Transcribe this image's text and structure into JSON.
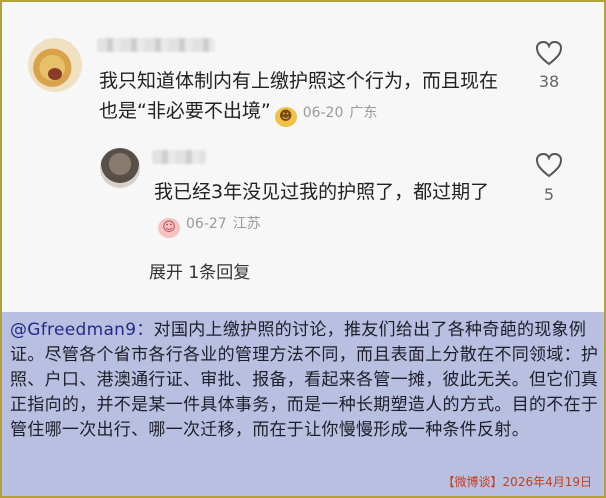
{
  "comments": [
    {
      "text": "我只知道体制内有上缴护照这个行为，而且现在也是“非必要不出境”",
      "emoji": "☻",
      "date": "06-20",
      "location": "广东",
      "likes": "38"
    },
    {
      "text": "我已经3年没见过我的护照了，都过期了",
      "emoji": "☺",
      "date": "06-27",
      "location": "江苏",
      "likes": "5"
    }
  ],
  "expand_replies": "展开 1条回复",
  "caption": {
    "username": "@Gfreedman9：",
    "body": "对国内上缴护照的讨论，推友们给出了各种奇葩的现象例证。尽管各个省市各行各业的管理方法不同，而且表面上分散在不同领域：护照、户口、港澳通行证、审批、报备，看起来各管一摊，彼此无关。但它们真正指向的，并不是某一件具体事务，而是一种长期塑造人的方式。目的不在于管住哪一次出行、哪一次迁移，而在于让你慢慢形成一种条件反射。"
  },
  "footer": "【微博谈】2026年4月19日",
  "colors": {
    "border": "#b5a13a",
    "caption_bg": "#b9bfe0",
    "footer_text": "#c04020"
  },
  "icons": [
    "heart-outline-icon"
  ]
}
